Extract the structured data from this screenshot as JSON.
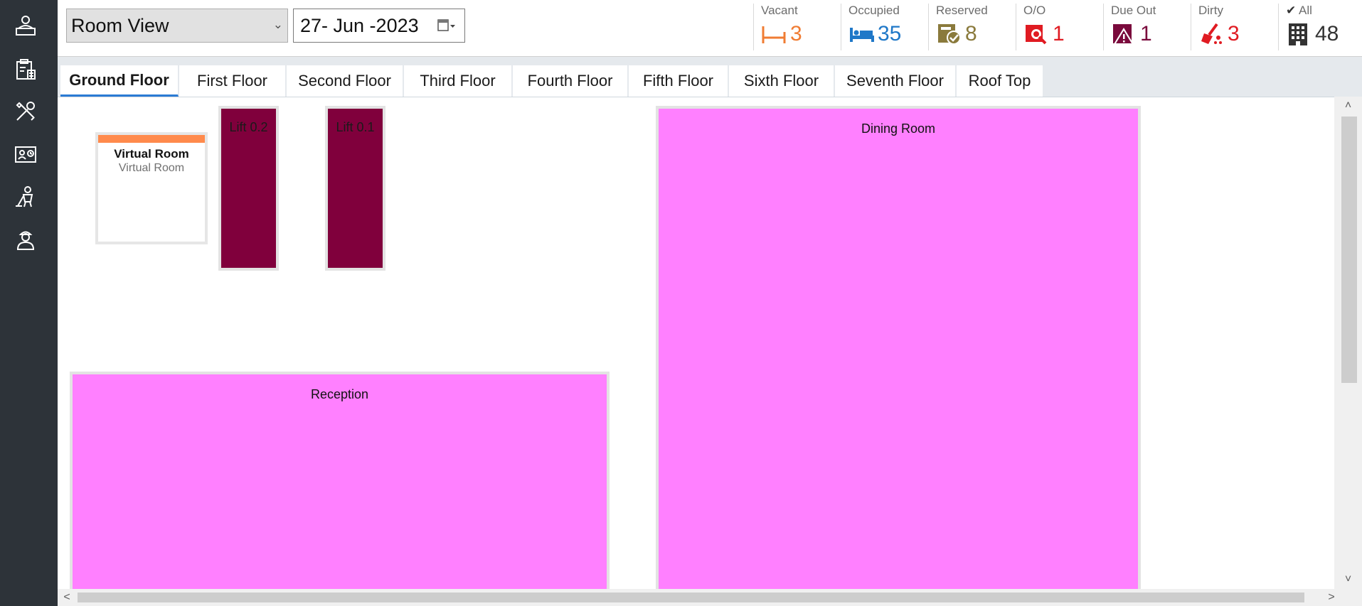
{
  "sidebar": {
    "items": [
      {
        "name": "front-desk-icon"
      },
      {
        "name": "reports-clipboard-icon"
      },
      {
        "name": "tools-icon"
      },
      {
        "name": "guest-card-icon"
      },
      {
        "name": "housekeeping-icon"
      },
      {
        "name": "staff-icon"
      }
    ]
  },
  "toolbar": {
    "view_select": "Room View",
    "date": "27- Jun -2023"
  },
  "stats": {
    "vacant": {
      "label": "Vacant",
      "count": "3",
      "color": "#f07c33"
    },
    "occupied": {
      "label": "Occupied",
      "count": "35",
      "color": "#1f78c8"
    },
    "reserved": {
      "label": "Reserved",
      "count": "8",
      "color": "#8a7a3c"
    },
    "oo": {
      "label": "O/O",
      "count": "1",
      "color": "#e01b22"
    },
    "dueout": {
      "label": "Due Out",
      "count": "1",
      "color": "#7a0a3c"
    },
    "dirty": {
      "label": "Dirty",
      "count": "3",
      "color": "#e01b22"
    },
    "all": {
      "label": "All",
      "count": "48",
      "color": "#333333"
    }
  },
  "tabs": [
    {
      "label": "Ground Floor",
      "active": true
    },
    {
      "label": "First Floor"
    },
    {
      "label": "Second Floor"
    },
    {
      "label": "Third Floor"
    },
    {
      "label": "Fourth Floor"
    },
    {
      "label": "Fifth Floor"
    },
    {
      "label": "Sixth Floor"
    },
    {
      "label": "Seventh Floor"
    },
    {
      "label": "Roof Top"
    }
  ],
  "floor": {
    "virtual_room": {
      "title": "Virtual Room",
      "subtitle": "Virtual Room"
    },
    "lift_02": "Lift 0.2",
    "lift_01": "Lift 0.1",
    "dining": "Dining Room",
    "reception": "Reception"
  },
  "colors": {
    "area": "#ff80ff",
    "lift": "#80003c",
    "virtual_room_bar": "#ff8a4c",
    "sidebar": "#2d3339"
  }
}
